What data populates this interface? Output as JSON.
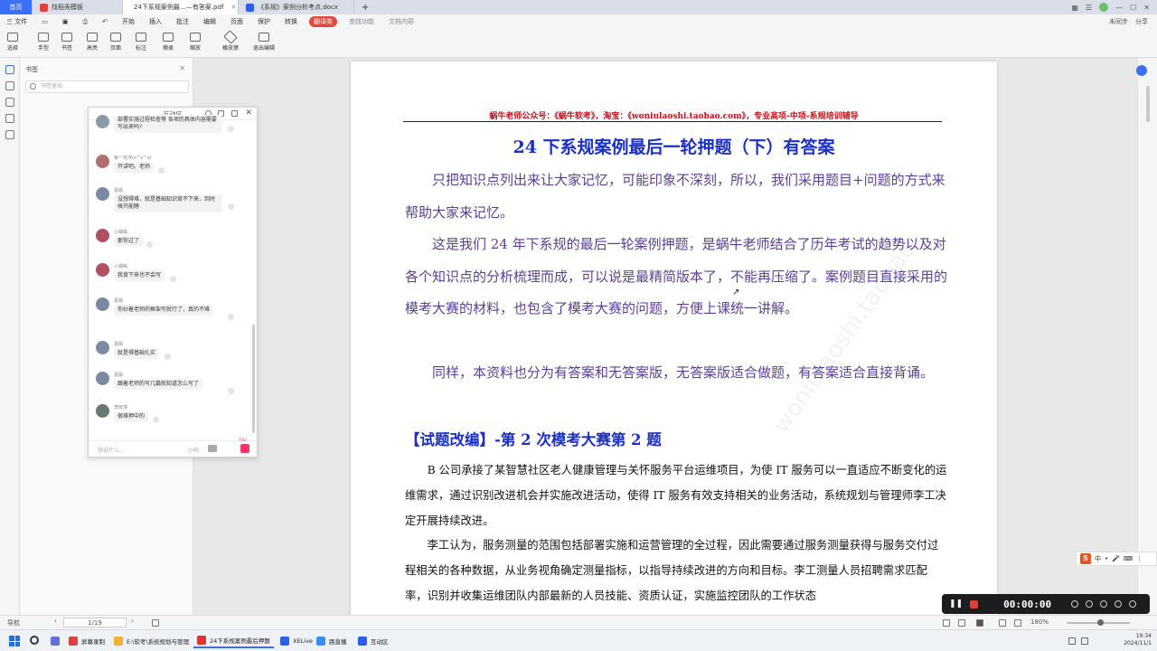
{
  "tabs": [
    {
      "label": "首页",
      "icon": "home"
    },
    {
      "label": "找稻壳模板",
      "icon": "docer-icon"
    },
    {
      "label": "24下系规案例最…—有答案.pdf",
      "icon": "pdf-icon"
    },
    {
      "label": "《系规》案例分析考点.docx",
      "icon": "word-icon"
    }
  ],
  "tab_new": "+",
  "window_controls": {
    "login": "未同步",
    "share": "分享"
  },
  "menu": {
    "file": "三 文件",
    "items": [
      "开始",
      "插入",
      "批注",
      "编辑",
      "页面",
      "保护",
      "转换"
    ],
    "active": "翻译类",
    "search": "查找功能",
    "doc_assistant": "文档内容"
  },
  "toolbar": {
    "items": [
      "选择",
      "手型",
      "书签",
      "高亮",
      "页面",
      "标注",
      "摘录",
      "缩放"
    ],
    "eraser": "橡皮擦",
    "exit_edit": "退出编辑"
  },
  "bookmark_panel": {
    "title": "书签",
    "search_placeholder": "书签查找"
  },
  "chat": {
    "title": "互动区",
    "messages": [
      {
        "sender": "",
        "text": "部署实施过程检查等 各项的具体内容需要写出来吗?",
        "avatar_color": "#8a9aa8"
      },
      {
        "sender": "鲸一羡浮(o^o^o)",
        "text": "开讲吧。老师",
        "avatar_color": "#b07070"
      },
      {
        "sender": "嘉娟",
        "text": "没想得难，就是基础知识背不下来，到时候只能瞎",
        "avatar_color": "#7a8aa0"
      },
      {
        "sender": "小蝴蛛",
        "text": "那你过了",
        "avatar_color": "#b05060"
      },
      {
        "sender": "小蝴蛛",
        "text": "我背下来也不会写",
        "avatar_color": "#b05060"
      },
      {
        "sender": "嘉娟",
        "text": "你纱着老师的框架写就行了，真的不难",
        "avatar_color": "#7a8aa0"
      },
      {
        "sender": "嘉娟",
        "text": "就是得基础扎实",
        "avatar_color": "#7a8aa0"
      },
      {
        "sender": "嘉娟",
        "text": "跟着老师的写几篇就知道怎么写了",
        "avatar_color": "#7a8aa0"
      },
      {
        "sender": "李晓涛",
        "text": "很难押中的",
        "avatar_color": "#6a7a70"
      }
    ],
    "input_placeholder": "想说什么…",
    "input_hint": "小响",
    "gift_tag": "TV好"
  },
  "document": {
    "header": "蜗牛老师公众号：《蜗牛软考》，淘宝：《woniulaoshi.taobao.com》，专业高项-中项-系规培训辅导",
    "title": "24 下系规案例最后一轮押题（下）有答案",
    "para1": "　　只把知识点列出来让大家记忆，可能印象不深刻，所以，我们采用题目+问题的方式来帮助大家来记忆。",
    "para2": "　　这是我们 24 年下系规的最后一轮案例押题，是蜗牛老师结合了历年考试的趋势以及对各个知识点的分析梳理而成，可以说是最精简版本了，不能再压缩了。案例题目直接采用的模考大赛的材料，也包含了模考大赛的问题，方便上课统一讲解。",
    "para3": "　　同样，本资料也分为有答案和无答案版，无答案版适合做题，有答案适合直接背诵。",
    "section_heading": "【试题改编】-第 2 次模考大赛第 2 题",
    "body1": "　　B 公司承接了某智慧社区老人健康管理与关怀服务平台运维项目，为使 IT 服务可以一直适应不断变化的运维需求，通过识别改进机会并实施改进活动，使得 IT 服务有效支持相关的业务活动，系统规划与管理师李工决定开展持续改进。",
    "body2": "　　李工认为，服务测量的范围包括部署实施和运营管理的全过程，因此需要通过服务测量获得与服务交付过程相关的各种数据，从业务视角确定测量指标，以指导持续改进的方向和目标。李工测量人员招聘需求匹配率，识别并收集运维团队内部最新的人员技能、资质认证，实施监控团队的工作状态",
    "watermark": "woniulaoshi.taobao"
  },
  "ime": {
    "logo": "S",
    "items": [
      "中",
      "•",
      "🎤",
      "⌨",
      "⋮"
    ]
  },
  "recorder": {
    "time": "00:00:00"
  },
  "status": {
    "nav": "导航",
    "page": "1/19",
    "zoom": "180%"
  },
  "taskbar": {
    "items": [
      {
        "label": "屏幕录制",
        "color": "#e04040"
      },
      {
        "label": "E:\\软考\\系统规划与管理",
        "color": "#f0b030"
      },
      {
        "label": "24下系规案例最后押题",
        "color": "#d33"
      },
      {
        "label": "XELive",
        "color": "#2c5ee8"
      },
      {
        "label": "路直播",
        "color": "#3a8ef0"
      },
      {
        "label": "互动区",
        "color": "#2c5ee8"
      }
    ],
    "time": "19:34",
    "date": "2024/11/1"
  },
  "colors": {
    "accent": "#3a6ff7",
    "header_red": "#c8101c",
    "title_blue": "#1a30c8",
    "para_purple": "#5a3f9a"
  }
}
